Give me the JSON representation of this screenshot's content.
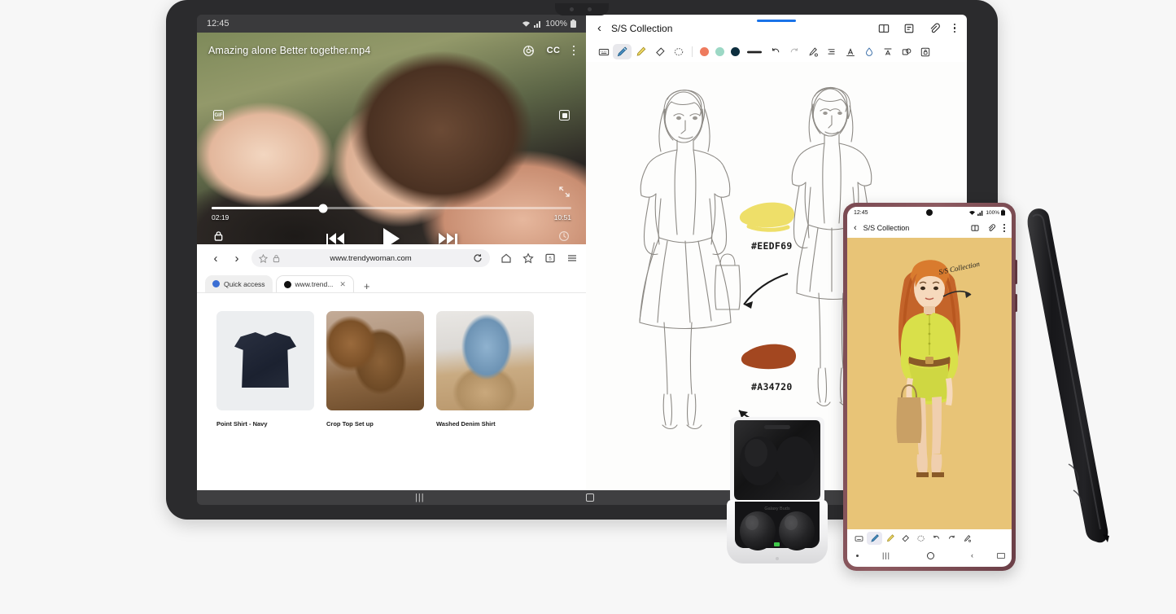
{
  "tablet": {
    "status": {
      "time": "12:45",
      "wifi_icon": "wifi-icon",
      "signal_icon": "signal-icon",
      "battery_pct": "100%",
      "battery_icon": "battery-icon"
    },
    "video": {
      "title": "Amazing alone Better together.mp4",
      "settings_icon": "video-settings-icon",
      "cc_label": "CC",
      "more_icon": "more-vertical-icon",
      "gif_label": "GIF",
      "pip_icon": "picture-in-picture-icon",
      "expand_icon": "expand-icon",
      "current_time": "02:19",
      "total_time": "10:51",
      "progress_pct": 31,
      "lock_icon": "lock-icon",
      "rotate_icon": "rotate-icon",
      "play_icon": "play-icon",
      "prev_icon": "skip-previous-icon",
      "next_icon": "skip-next-icon"
    },
    "browser": {
      "back_icon": "chevron-left-icon",
      "forward_icon": "chevron-right-icon",
      "star_icon": "star-icon",
      "lock_icon": "lock-icon",
      "url": "www.trendywoman.com",
      "reload_icon": "reload-icon",
      "home_icon": "home-icon",
      "bookmark_icon": "bookmark-add-icon",
      "tabs_icon": "tabs-icon",
      "tabs_count": "5",
      "menu_icon": "hamburger-menu-icon",
      "tabs": [
        {
          "label": "Quick access",
          "favicon": "quick-access-icon",
          "closable": false
        },
        {
          "label": "www.trend...",
          "favicon": "site-favicon",
          "closable": true
        }
      ],
      "new_tab_label": "+",
      "products": [
        {
          "name": "Point Shirt - Navy"
        },
        {
          "name": "Crop Top Set up"
        },
        {
          "name": "Washed Denim Shirt"
        }
      ]
    },
    "notes": {
      "back_icon": "chevron-left-icon",
      "title": "S/S Collection",
      "book_icon": "book-view-icon",
      "note_icon": "note-icon",
      "attach_icon": "paperclip-icon",
      "more_icon": "more-vertical-icon",
      "toolbar": [
        {
          "name": "keyboard-icon",
          "selected": false
        },
        {
          "name": "pen-icon",
          "selected": true
        },
        {
          "name": "highlighter-icon",
          "selected": false
        },
        {
          "name": "eraser-icon",
          "selected": false
        },
        {
          "name": "lasso-select-icon",
          "selected": false
        }
      ],
      "colors": [
        "#EE7B5E",
        "#9CD8C5",
        "#0D2E3E"
      ],
      "thickness_icon": "line-thickness-icon",
      "undo_icon": "undo-icon",
      "redo_icon": "redo-icon",
      "extra_tools": [
        "pen-settings-icon",
        "align-icon",
        "text-mode-icon",
        "water-drop-icon",
        "text-extract-icon",
        "shape-icon",
        "lock-note-icon"
      ],
      "annotations": [
        {
          "hex": "#EEDF69",
          "swatch": "#EEDF69"
        },
        {
          "hex": "#A34720",
          "swatch": "#A34720"
        }
      ]
    },
    "navbar": {
      "recents_icon": "recents-icon",
      "home_icon": "home-icon"
    }
  },
  "phone": {
    "status": {
      "time": "12:45",
      "wifi_icon": "wifi-icon",
      "signal_icon": "signal-icon",
      "battery_pct": "100%",
      "battery_icon": "battery-icon"
    },
    "header": {
      "back_icon": "chevron-left-icon",
      "title": "S/S Collection",
      "book_icon": "book-view-icon",
      "attach_icon": "paperclip-icon",
      "more_icon": "more-vertical-icon"
    },
    "sketch_annotation": "S/S Collection",
    "toolbar": [
      {
        "name": "keyboard-icon",
        "selected": false
      },
      {
        "name": "pen-icon",
        "selected": true
      },
      {
        "name": "highlighter-icon",
        "selected": false
      },
      {
        "name": "eraser-icon",
        "selected": false
      },
      {
        "name": "lasso-select-icon",
        "selected": false
      },
      {
        "name": "undo-icon",
        "selected": false
      },
      {
        "name": "redo-icon",
        "selected": false
      },
      {
        "name": "pen-settings-icon",
        "selected": false
      }
    ],
    "navbar": {
      "recents_icon": "recents-icon",
      "home_icon": "home-icon",
      "back_icon": "back-icon",
      "keyboard_icon": "keyboard-icon"
    }
  },
  "accessories": {
    "stylus": "s-pen-stylus",
    "earbuds": "galaxy-buds-case"
  },
  "colors": {
    "accent_blue": "#1a73e8",
    "yellow_swatch": "#EEDF69",
    "rust_swatch": "#A34720",
    "phone_frame": "#7a4a52",
    "canvas_yellow": "#e8c477"
  }
}
